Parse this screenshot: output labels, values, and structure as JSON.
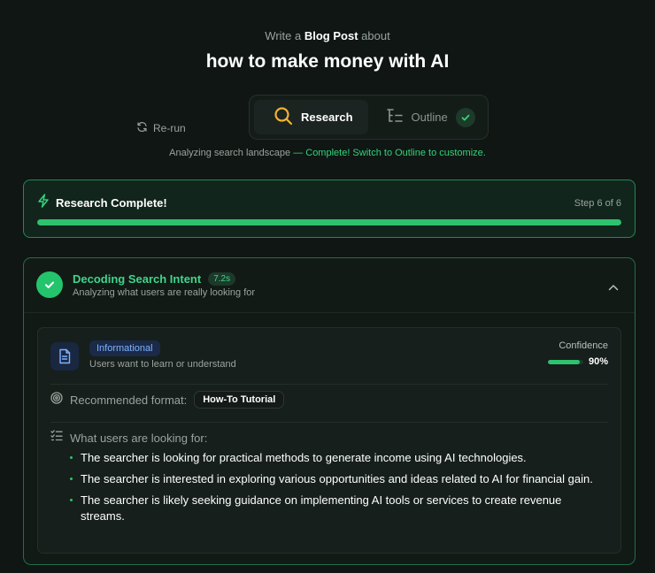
{
  "header": {
    "intro_prefix": "Write a",
    "content_type": "Blog Post",
    "intro_suffix": "about",
    "topic": "how to make money with AI"
  },
  "controls": {
    "rerun_label": "Re-run",
    "tabs": [
      {
        "label": "Research",
        "icon": "search-icon",
        "state": "active"
      },
      {
        "label": "Outline",
        "icon": "outline-icon",
        "state": "completed"
      }
    ]
  },
  "status": {
    "prefix": "Analyzing search landscape",
    "highlight": "— Complete! Switch to Outline to customize."
  },
  "progress": {
    "title": "Research Complete!",
    "step_label": "Step 6 of 6",
    "fraction": 1.0
  },
  "intent_section": {
    "title": "Decoding Search Intent",
    "duration": "7.2s",
    "subtitle": "Analyzing what users are really looking for",
    "intent_type": "Informational",
    "intent_description": "Users want to learn or understand",
    "confidence_label": "Confidence",
    "confidence_value": "90%",
    "confidence_fraction": 0.9,
    "format_label": "Recommended format:",
    "format_value": "How-To Tutorial",
    "looking_for_label": "What users are looking for:",
    "points": [
      "The searcher is looking for practical methods to generate income using AI technologies.",
      "The searcher is interested in exploring various opportunities and ideas related to AI for financial gain.",
      "The searcher is likely seeking guidance on implementing AI tools or services to create revenue streams."
    ]
  },
  "colors": {
    "accent_green": "#2ec26e",
    "text_green": "#3fd68a",
    "info_blue": "#7fb2ff",
    "background": "#0f1613"
  }
}
